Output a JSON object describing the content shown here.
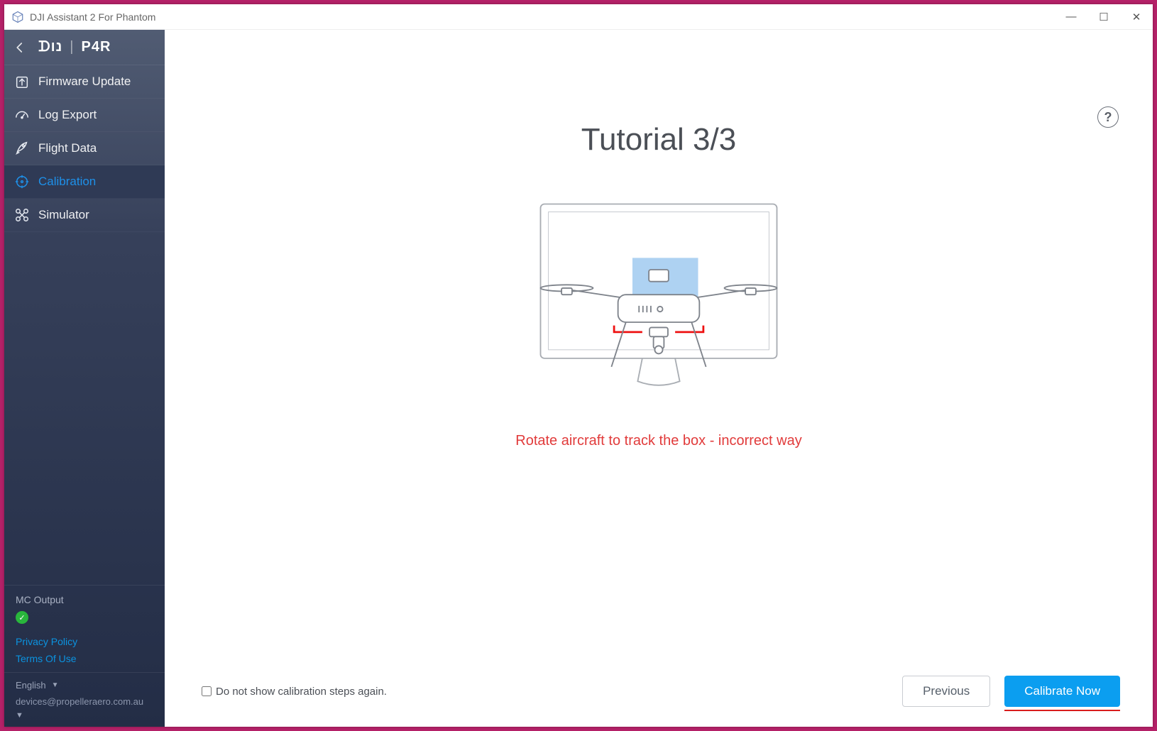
{
  "window": {
    "title": "DJI Assistant 2 For Phantom"
  },
  "sidebar": {
    "brand_left": "ᗪנו",
    "brand_right": "P4R",
    "items": [
      {
        "label": "Firmware Update"
      },
      {
        "label": "Log Export"
      },
      {
        "label": "Flight Data"
      },
      {
        "label": "Calibration"
      },
      {
        "label": "Simulator"
      }
    ],
    "mc_label": "MC Output",
    "links": {
      "privacy": "Privacy Policy",
      "terms": "Terms Of Use"
    },
    "language": "English",
    "email": "devices@propelleraero.com.au"
  },
  "main": {
    "title": "Tutorial 3/3",
    "instruction": "Rotate aircraft to track the box - incorrect way",
    "no_show_label": "Do not show calibration steps again.",
    "prev_btn": "Previous",
    "calibrate_btn": "Calibrate Now",
    "help_char": "?"
  },
  "status_ok_char": "✓"
}
